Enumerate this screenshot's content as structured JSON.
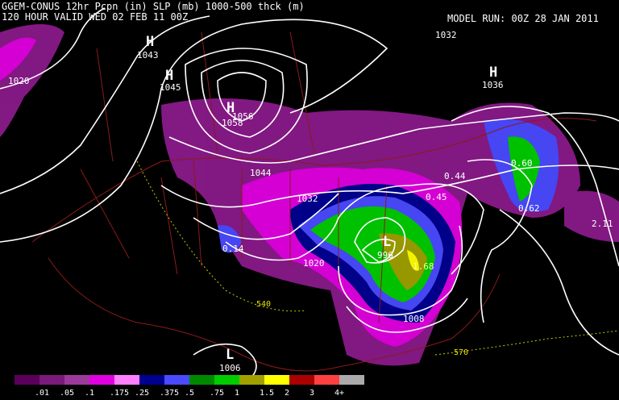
{
  "header": {
    "title_line1": "GGEM-CONUS 12hr Pcpn (in) SLP (mb) 1000-500 thck (m)",
    "title_line2": "120 HOUR VALID WED 02 FEB 11 00Z",
    "model_run": "MODEL RUN: 00Z 28 JAN 2011"
  },
  "pressure_centers": {
    "h1": "H",
    "h1_val": "1043",
    "h2": "H",
    "h2_val": "1045",
    "h3": "H",
    "h3_val": "1056",
    "h3_val2": "1058",
    "h4": "H",
    "h4_val": "1036",
    "l1": "L",
    "l1_val": "996",
    "l2": "L",
    "l2_val": "1006"
  },
  "isobar_labels": [
    "1020",
    "1032",
    "1044",
    "1032",
    "1020",
    "1008"
  ],
  "precip_values": [
    "0.44",
    "0.45",
    "0.60",
    "0.62",
    "0.14",
    "1.68",
    "2.11"
  ],
  "thickness_labels": [
    "540",
    "570"
  ],
  "legend": {
    "colors": [
      "#5a005a",
      "#7a1a7a",
      "#9b3a9b",
      "#e000e0",
      "#ff80ff",
      "#000090",
      "#4a4aff",
      "#008800",
      "#00cc00",
      "#a0a000",
      "#ffff00",
      "#aa0000",
      "#ff4040",
      "#aaaaaa"
    ],
    "labels": [
      ".01",
      ".05",
      ".1",
      ".175",
      ".25",
      ".375",
      ".5",
      ".75",
      "1",
      "1.5",
      "2",
      "3",
      "4+"
    ]
  }
}
